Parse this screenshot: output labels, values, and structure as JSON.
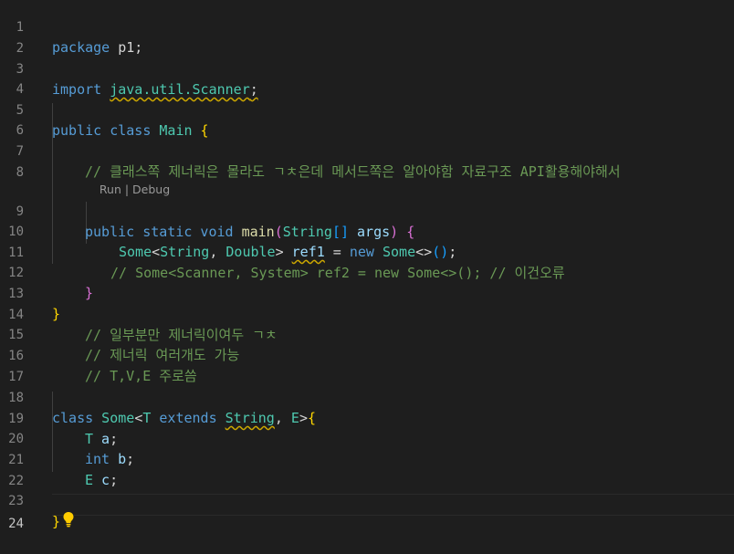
{
  "editor": {
    "line_numbers": [
      "1",
      "2",
      "3",
      "4",
      "5",
      "6",
      "7",
      "8",
      "9",
      "10",
      "11",
      "12",
      "13",
      "14",
      "15",
      "16",
      "17",
      "18",
      "19",
      "20",
      "21",
      "22",
      "23",
      "24"
    ],
    "codelens": {
      "run": "Run",
      "sep": " | ",
      "debug": "Debug"
    },
    "code": {
      "l1_kw": "package",
      "l1_rest": " p1;",
      "l3_kw": "import",
      "l3_sp": " ",
      "l3_path": "java.util.Scanner",
      "l3_semi": ";",
      "l5_kw1": "public",
      "l5_kw2": " class",
      "l5_name": " Main",
      "l5_brace": " {",
      "l7_comment": "// 클래스쪽 제너릭은 몰라도 ㄱㅊ은데 메서드쪽은 알아야함 자료구조 API활용해야해서",
      "l9_kw1": "public",
      "l9_kw2": " static",
      "l9_kw3": " void",
      "l9_fn": " main",
      "l9_p1": "(",
      "l9_t": "String",
      "l9_arr": "[]",
      "l9_arg": " args",
      "l9_p2": ")",
      "l9_b": " {",
      "l10_t1": "Some",
      "l10_lt": "<",
      "l10_t2": "String",
      "l10_c": ", ",
      "l10_t3": "Double",
      "l10_gt": "> ",
      "l10_var": "ref1",
      "l10_eq": " = ",
      "l10_new": "new",
      "l10_t4": " Some",
      "l10_dia": "<>",
      "l10_paren": "()",
      "l10_semi": ";",
      "l11_comment": "// Some<Scanner, System> ref2 = new Some<>(); // 이건오류",
      "l12_brace": "}",
      "l13_brace": "}",
      "l14_comment": "// 일부분만 제너릭이여두 ㄱㅊ",
      "l15_comment": "// 제너릭 여러개도 가능",
      "l16_comment": "// T,V,E 주로씀",
      "l18_kw": "class",
      "l18_name": " Some",
      "l18_lt": "<",
      "l18_t": "T",
      "l18_ext": " extends",
      "l18_sp": " ",
      "l18_str": "String",
      "l18_c": ", ",
      "l18_e": "E",
      "l18_gt": ">",
      "l18_b": "{",
      "l19_t": "T",
      "l19_v": " a",
      "l19_s": ";",
      "l20_t": "int",
      "l20_v": " b",
      "l20_s": ";",
      "l21_t": "E",
      "l21_v": " c",
      "l21_s": ";",
      "l23_brace": "}"
    }
  },
  "colors": {
    "background": "#1e1e1e",
    "keyword": "#569cd6",
    "type": "#4ec9b0",
    "function": "#dcdcaa",
    "variable": "#9cdcfe",
    "comment": "#6a9955",
    "bracket_1": "#ffd700",
    "bracket_2": "#da70d6",
    "bracket_3": "#179fff",
    "warning_squiggle": "#cca700"
  },
  "icons": {
    "lightbulb": "lightbulb-icon"
  }
}
